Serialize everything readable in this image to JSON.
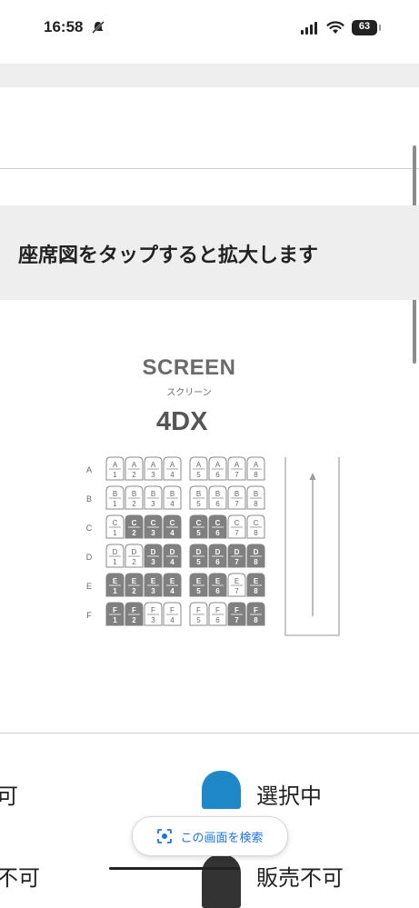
{
  "status_bar": {
    "time": "16:58",
    "battery": "63"
  },
  "banner": {
    "text": "座席図をタップすると拡大します"
  },
  "screen": {
    "label": "SCREEN",
    "kana": "スクリーン",
    "format_logo": "4DX"
  },
  "seat_map": {
    "rows": [
      {
        "label": "A",
        "seats": [
          {
            "n": "1",
            "s": "available"
          },
          {
            "n": "2",
            "s": "available"
          },
          {
            "n": "3",
            "s": "available"
          },
          {
            "n": "4",
            "s": "available"
          },
          {
            "n": "5",
            "s": "available"
          },
          {
            "n": "6",
            "s": "available"
          },
          {
            "n": "7",
            "s": "available"
          },
          {
            "n": "8",
            "s": "available"
          }
        ]
      },
      {
        "label": "B",
        "seats": [
          {
            "n": "1",
            "s": "available"
          },
          {
            "n": "2",
            "s": "available"
          },
          {
            "n": "3",
            "s": "available"
          },
          {
            "n": "4",
            "s": "available"
          },
          {
            "n": "5",
            "s": "available"
          },
          {
            "n": "6",
            "s": "available"
          },
          {
            "n": "7",
            "s": "available"
          },
          {
            "n": "8",
            "s": "available"
          }
        ]
      },
      {
        "label": "C",
        "seats": [
          {
            "n": "1",
            "s": "available"
          },
          {
            "n": "2",
            "s": "sold"
          },
          {
            "n": "3",
            "s": "sold"
          },
          {
            "n": "4",
            "s": "sold"
          },
          {
            "n": "5",
            "s": "sold"
          },
          {
            "n": "6",
            "s": "sold"
          },
          {
            "n": "7",
            "s": "available"
          },
          {
            "n": "8",
            "s": "available"
          }
        ]
      },
      {
        "label": "D",
        "seats": [
          {
            "n": "1",
            "s": "available"
          },
          {
            "n": "2",
            "s": "available"
          },
          {
            "n": "3",
            "s": "sold"
          },
          {
            "n": "4",
            "s": "sold"
          },
          {
            "n": "5",
            "s": "sold"
          },
          {
            "n": "6",
            "s": "sold"
          },
          {
            "n": "7",
            "s": "sold"
          },
          {
            "n": "8",
            "s": "sold"
          }
        ]
      },
      {
        "label": "E",
        "seats": [
          {
            "n": "1",
            "s": "sold"
          },
          {
            "n": "2",
            "s": "sold"
          },
          {
            "n": "3",
            "s": "sold"
          },
          {
            "n": "4",
            "s": "sold"
          },
          {
            "n": "5",
            "s": "sold"
          },
          {
            "n": "6",
            "s": "sold"
          },
          {
            "n": "7",
            "s": "available"
          },
          {
            "n": "8",
            "s": "sold"
          }
        ]
      },
      {
        "label": "F",
        "seats": [
          {
            "n": "1",
            "s": "sold"
          },
          {
            "n": "2",
            "s": "sold"
          },
          {
            "n": "3",
            "s": "available"
          },
          {
            "n": "4",
            "s": "available"
          },
          {
            "n": "5",
            "s": "available"
          },
          {
            "n": "6",
            "s": "available"
          },
          {
            "n": "7",
            "s": "sold"
          },
          {
            "n": "8",
            "s": "sold"
          }
        ]
      }
    ]
  },
  "legend": {
    "left_label_1": "可",
    "left_label_2": "不可",
    "selected_label": "選択中",
    "selected_color": "#1e88c8",
    "sold_label": "販売不可",
    "sold_color": "#333333"
  },
  "lens": {
    "text": "この画面を検索"
  }
}
